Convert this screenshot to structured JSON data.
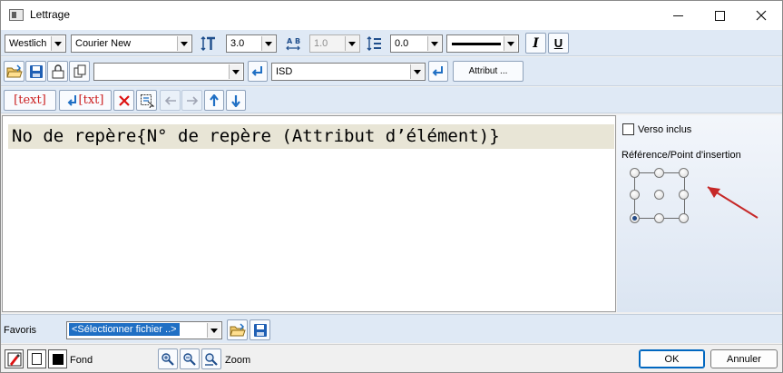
{
  "window": {
    "title": "Lettrage"
  },
  "toolbar1": {
    "font_style": "Westlich",
    "font_name": "Courier New",
    "text_height": "3.0",
    "char_spacing": "1.0",
    "line_spacing": "0.0",
    "italic_label": "I",
    "underline_label": "U"
  },
  "toolbar2": {
    "template_value": "",
    "layer_value": "ISD",
    "attribute_button": "Attribut ..."
  },
  "toolbar3": {
    "insert_text_label": "text",
    "edit_text_label": "txt"
  },
  "editor": {
    "content": "No de repère{N° de repère (Attribut d’élément)}"
  },
  "side_panel": {
    "verso_label": "Verso inclus",
    "verso_checked": false,
    "reference_title": "Référence/Point d'insertion",
    "selected_point": "bottom-left"
  },
  "favorites": {
    "label": "Favoris",
    "select_value": "<Sélectionner fichier ..>"
  },
  "bottom": {
    "fond_label": "Fond",
    "zoom_label": "Zoom",
    "ok_label": "OK",
    "cancel_label": "Annuler"
  },
  "colors": {
    "accent": "#1f6fc4",
    "red_icon": "#cc1f1f",
    "toolbar_bg": "#dfe9f5",
    "text_highlight": "#e8e5d6"
  },
  "icons": {
    "text_height": "text-height-icon",
    "char_spacing": "char-spacing-icon",
    "line_spacing": "line-spacing-icon"
  }
}
